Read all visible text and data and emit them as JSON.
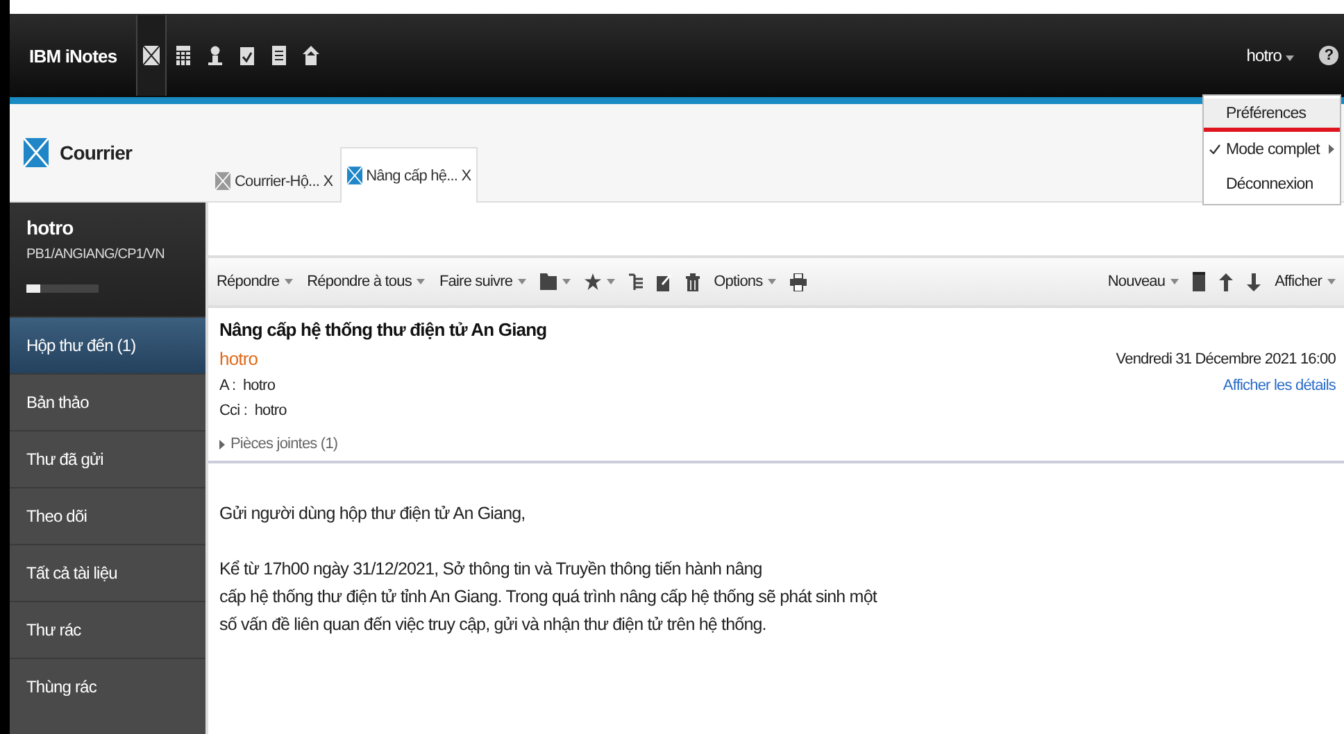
{
  "app": {
    "brand": "IBM iNotes",
    "nav_icons": [
      {
        "kind": "mail",
        "selected": true
      },
      {
        "kind": "calendar",
        "selected": false
      },
      {
        "kind": "contacts",
        "selected": false
      },
      {
        "kind": "todo",
        "selected": false
      },
      {
        "kind": "notebook",
        "selected": false
      },
      {
        "kind": "home",
        "selected": false
      }
    ],
    "user": "hotro",
    "help": "?"
  },
  "user_menu": {
    "items": [
      {
        "label": "Préférences",
        "checked": false,
        "submenu": false,
        "highlighted": true
      },
      {
        "label": "Mode complet",
        "checked": true,
        "submenu": true,
        "highlighted": false
      },
      {
        "label": "Déconnexion",
        "checked": false,
        "submenu": false,
        "highlighted": false
      }
    ]
  },
  "section": {
    "title": "Courrier"
  },
  "tabs": [
    {
      "label": "Courrier-Hộ...",
      "close": "X",
      "selected": false
    },
    {
      "label": "Nâng cấp hệ...",
      "close": "X",
      "selected": true
    }
  ],
  "sidebar": {
    "user": "hotro",
    "server": "PB1/ANGIANG/CP1/VN",
    "quota": {
      "level": 0.2
    },
    "items": [
      {
        "label": "Hộp thư đến (1)",
        "selected": true
      },
      {
        "label": "Bản thảo",
        "selected": false
      },
      {
        "label": "Thư đã gửi",
        "selected": false
      },
      {
        "label": "Theo dõi",
        "selected": false
      },
      {
        "label": "Tất cả tài liệu",
        "selected": false
      },
      {
        "label": "Thư rác",
        "selected": false
      },
      {
        "label": "Thùng rác",
        "selected": false
      }
    ]
  },
  "toolbar": {
    "left": [
      {
        "kind": "menu",
        "label": "Répondre"
      },
      {
        "kind": "menu",
        "label": "Répondre à tous"
      },
      {
        "kind": "menu",
        "label": "Faire suivre"
      },
      {
        "kind": "folder",
        "dropdown": true
      },
      {
        "kind": "star",
        "dropdown": true
      },
      {
        "kind": "list",
        "dropdown": false
      },
      {
        "kind": "edit",
        "dropdown": false
      },
      {
        "kind": "trash",
        "dropdown": false
      },
      {
        "kind": "menu",
        "label": "Options"
      },
      {
        "kind": "print",
        "dropdown": false
      }
    ],
    "right": [
      {
        "kind": "menu",
        "label": "Nouveau"
      },
      {
        "kind": "doc",
        "dropdown": false
      },
      {
        "kind": "up",
        "dropdown": false
      },
      {
        "kind": "down",
        "dropdown": false
      },
      {
        "kind": "menu",
        "label": "Afficher"
      }
    ]
  },
  "message": {
    "subject": "Nâng cấp hệ thống thư điện tử An Giang",
    "from": "hotro",
    "date": "Vendredi 31 Décembre 2021 16:00",
    "details_link": "Afficher les détails",
    "recipients": [
      {
        "label": "A :",
        "value": "hotro"
      },
      {
        "label": "Cci :",
        "value": "hotro"
      }
    ],
    "attachments": "Pièces jointes (1)",
    "body": [
      [
        "Gửi người dùng hộp thư điện tử An Giang,"
      ],
      [
        "Kể từ 17h00 ngày 31/12/2021, Sở thông tin và Truyền thông tiến hành nâng",
        "cấp hệ thống thư điện tử tỉnh An Giang. Trong quá trình nâng cấp hệ thống sẽ phát sinh một",
        "số vấn đề liên quan đến việc truy cập, gửi và nhận thư điện tử trên hệ thống."
      ]
    ]
  }
}
